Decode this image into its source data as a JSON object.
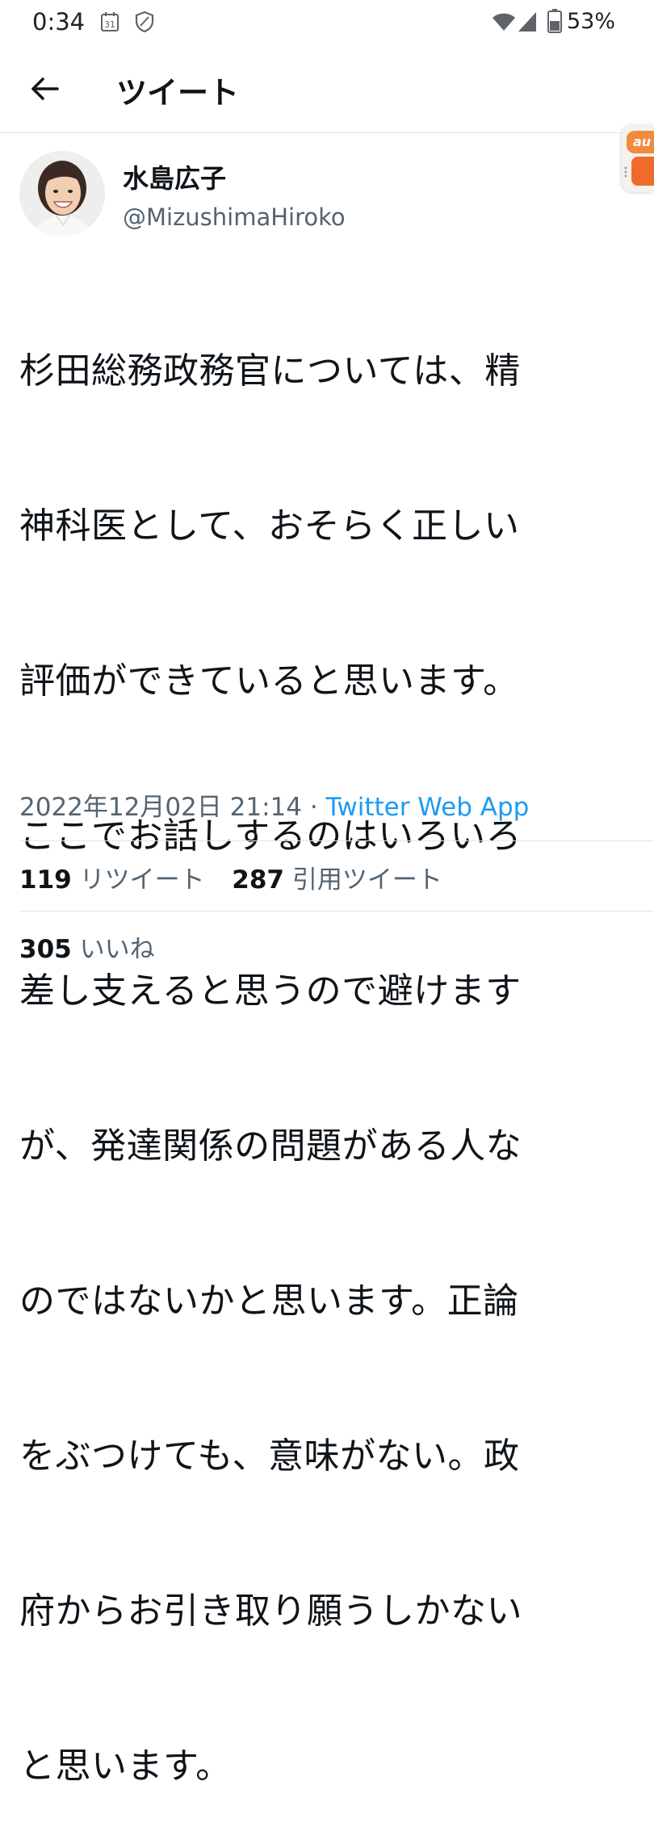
{
  "status_bar": {
    "time": "0:34",
    "calendar_day": "31",
    "battery": "53%"
  },
  "header": {
    "title": "ツイート",
    "back_icon": "arrow-left-icon"
  },
  "side_widget": {
    "label": "au"
  },
  "tweet": {
    "author_name": "水島広子",
    "author_handle": "@MizushimaHiroko",
    "lines": [
      "杉田総務政務官については、精",
      "神科医として、おそらく正しい",
      "評価ができていると思います。",
      "ここでお話しするのはいろいろ",
      "差し支えると思うので避けます",
      "が、発達関係の問題がある人な",
      "のではないかと思います。正論",
      "をぶつけても、意味がない。政",
      "府からお引き取り願うしかない",
      "と思います。"
    ],
    "timestamp": "2022年12月02日 21:14",
    "separator": " · ",
    "source": "Twitter Web App"
  },
  "stats": {
    "retweets_count": "119",
    "retweets_label": "リツイート",
    "quotes_count": "287",
    "quotes_label": "引用ツイート",
    "likes_count": "305",
    "likes_label": "いいね"
  },
  "colors": {
    "link": "#1d9bf0",
    "secondary_text": "#536471",
    "primary_text": "#0f1419"
  }
}
